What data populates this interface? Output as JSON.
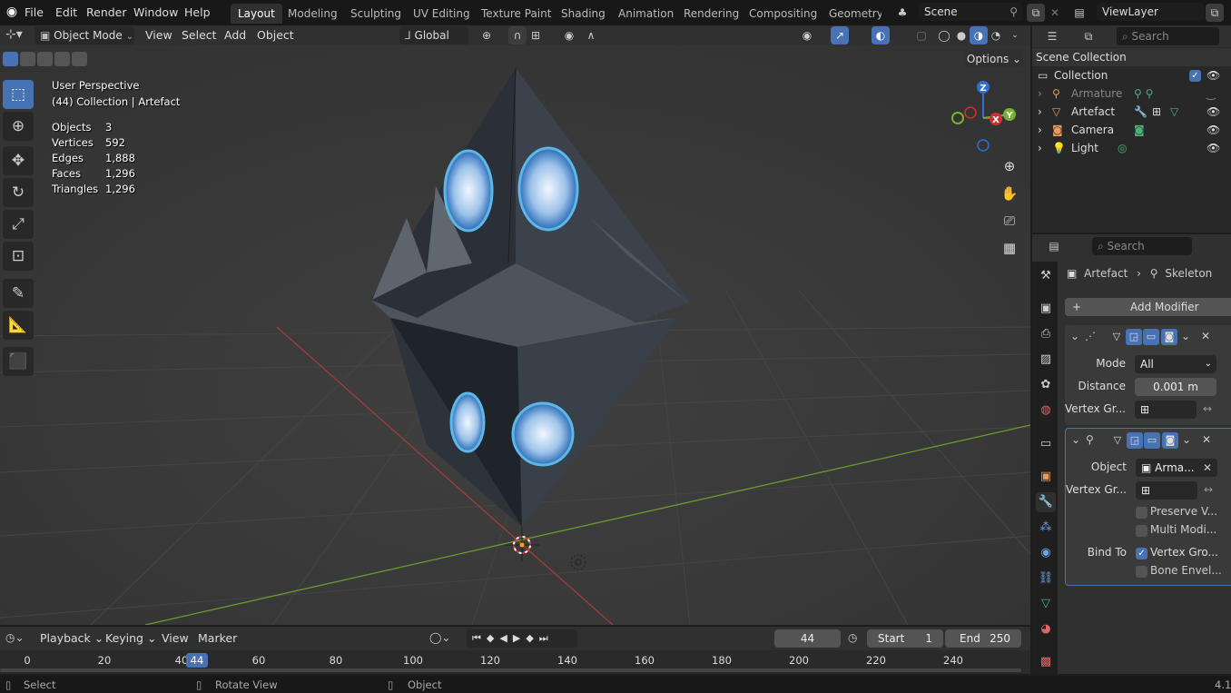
{
  "menus": [
    "File",
    "Edit",
    "Render",
    "Window",
    "Help"
  ],
  "workspaces": [
    "Layout",
    "Modeling",
    "Sculpting",
    "UV Editing",
    "Texture Paint",
    "Shading",
    "Animation",
    "Rendering",
    "Compositing",
    "Geometry N"
  ],
  "scene": "Scene",
  "viewlayer": "ViewLayer",
  "viewport_header": {
    "mode": "Object Mode",
    "menus": [
      "View",
      "Select",
      "Add",
      "Object"
    ],
    "orientation": "Global",
    "options": "Options"
  },
  "overlay": {
    "perspective": "User Perspective",
    "collection": "(44) Collection | Artefact",
    "stats": [
      {
        "label": "Objects",
        "value": "3"
      },
      {
        "label": "Vertices",
        "value": "592"
      },
      {
        "label": "Edges",
        "value": "1,888"
      },
      {
        "label": "Faces",
        "value": "1,296"
      },
      {
        "label": "Triangles",
        "value": "1,296"
      }
    ]
  },
  "gizmo": {
    "z": "Z",
    "x": "X",
    "y": "Y"
  },
  "outliner": {
    "search_placeholder": "Search",
    "root": "Scene Collection",
    "collection": "Collection",
    "items": [
      {
        "name": "Armature",
        "icon": "armature-icon",
        "dim": true
      },
      {
        "name": "Artefact",
        "icon": "mesh-icon",
        "dim": false
      },
      {
        "name": "Camera",
        "icon": "camera-icon",
        "dim": false
      },
      {
        "name": "Light",
        "icon": "light-icon",
        "dim": false
      }
    ]
  },
  "properties": {
    "search_placeholder": "Search",
    "breadcrumb_object": "Artefact",
    "breadcrumb_modifier": "Skeleton",
    "add_modifier": "Add Modifier",
    "weld": {
      "mode_label": "Mode",
      "mode_value": "All",
      "distance_label": "Distance",
      "distance_value": "0.001 m",
      "vgroup_label": "Vertex Gr..."
    },
    "armature": {
      "object_label": "Object",
      "object_value": "Arma...",
      "vgroup_label": "Vertex Gr...",
      "preserve": "Preserve V...",
      "multi": "Multi Modi...",
      "bind_label": "Bind To",
      "bind_vgroups": "Vertex Gro...",
      "bind_env": "Bone Envel..."
    }
  },
  "timeline": {
    "menus": [
      "Playback",
      "Keying",
      "View",
      "Marker"
    ],
    "current_frame": "44",
    "start_label": "Start",
    "start_value": "1",
    "end_label": "End",
    "end_value": "250",
    "ticks": [
      "0",
      "20",
      "40",
      "60",
      "80",
      "100",
      "120",
      "140",
      "160",
      "180",
      "200",
      "220",
      "240"
    ],
    "playhead": "44"
  },
  "statusbar": {
    "select": "Select",
    "rotate": "Rotate View",
    "object": "Object",
    "version": "4.1"
  },
  "colors": {
    "accent": "#4772b3",
    "header": "#303030",
    "viewport": "#393939"
  }
}
